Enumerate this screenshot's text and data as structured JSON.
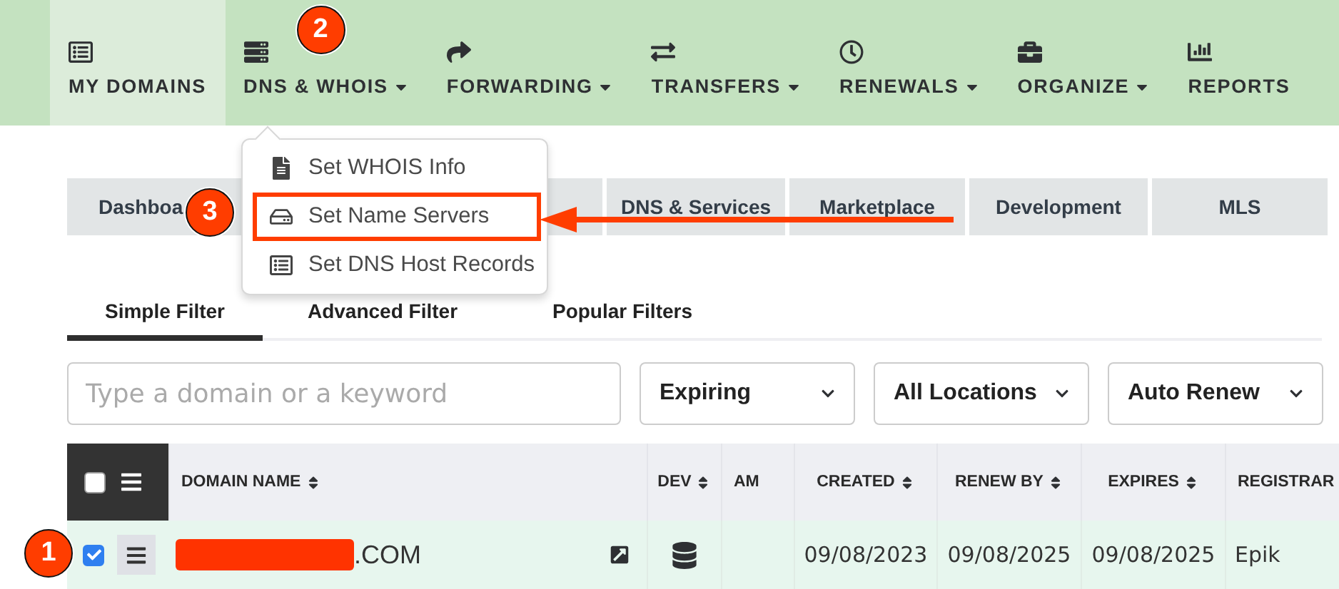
{
  "nav": {
    "items": [
      {
        "label": "MY DOMAINS",
        "selected": true,
        "has_menu": false
      },
      {
        "label": "DNS & WHOIS",
        "selected": false,
        "has_menu": true,
        "step_marker": "2"
      },
      {
        "label": "FORWARDING",
        "selected": false,
        "has_menu": true
      },
      {
        "label": "TRANSFERS",
        "selected": false,
        "has_menu": true
      },
      {
        "label": "RENEWALS",
        "selected": false,
        "has_menu": true
      },
      {
        "label": "ORGANIZE",
        "selected": false,
        "has_menu": true
      },
      {
        "label": "REPORTS",
        "selected": false,
        "has_menu": false
      }
    ]
  },
  "dns_menu": {
    "items": [
      {
        "label": "Set WHOIS Info",
        "highlighted": false
      },
      {
        "label": "Set Name Servers",
        "highlighted": true,
        "step_marker": "3"
      },
      {
        "label": "Set DNS Host Records",
        "highlighted": false
      }
    ]
  },
  "section_tabs": [
    {
      "label": "Dashboa"
    },
    {
      "label": "DNS & Services"
    },
    {
      "label": "Marketplace"
    },
    {
      "label": "Development"
    },
    {
      "label": "MLS"
    }
  ],
  "filter_tabs": [
    {
      "label": "Simple Filter",
      "selected": true
    },
    {
      "label": "Advanced Filter",
      "selected": false
    },
    {
      "label": "Popular Filters",
      "selected": false
    }
  ],
  "search": {
    "placeholder": "Type a domain or a keyword"
  },
  "filters": [
    "Expiring",
    "All Locations",
    "Auto Renew"
  ],
  "table": {
    "select_all_checked": false,
    "columns": [
      {
        "label": "DOMAIN NAME",
        "sortable": true
      },
      {
        "label": "DEV",
        "sortable": true
      },
      {
        "label": "AM",
        "sortable": false
      },
      {
        "label": "CREATED",
        "sortable": true
      },
      {
        "label": "RENEW BY",
        "sortable": true
      },
      {
        "label": "EXPIRES",
        "sortable": true
      },
      {
        "label": "REGISTRAR"
      }
    ],
    "rows": [
      {
        "checked": true,
        "redacted": true,
        "domain_suffix": ".COM",
        "created": "09/08/2023",
        "renew_by": "09/08/2025",
        "expires": "09/08/2025",
        "registrar": "Epik",
        "step_marker": "1"
      }
    ]
  }
}
